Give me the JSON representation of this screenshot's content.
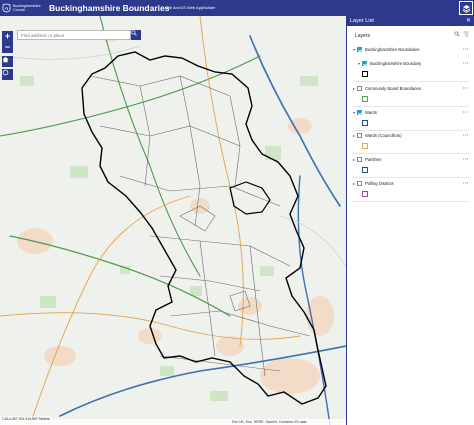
{
  "header": {
    "logo_text": "Buckinghamshire Council",
    "title": "Buckinghamshire Boundaries",
    "subtitle": "with ArcGIS Web AppBuilder"
  },
  "search": {
    "placeholder": "Find address or place"
  },
  "zoom": {
    "in_label": "+",
    "out_label": "−"
  },
  "map": {
    "scale_text": "1,614,337 291,914,597 Meters",
    "attribution": "Esri UK, Esri, HERE, Garmin, Contains OS data"
  },
  "panel": {
    "title": "Layer List",
    "close_label": "✕",
    "layers_label": "Layers",
    "items": [
      {
        "label": "Buckinghamshire Boundaries",
        "checked": true,
        "swatch": ""
      },
      {
        "label": "Buckinghamshire Boundary",
        "checked": true,
        "swatch": "#000000"
      },
      {
        "label": "Community Board Boundaries",
        "checked": false,
        "swatch": "#4aa84a"
      },
      {
        "label": "Wards",
        "checked": true,
        "swatch": "#1f4f8f"
      },
      {
        "label": "Wards (Councillors)",
        "checked": false,
        "swatch": "#e8a84a"
      },
      {
        "label": "Parishes",
        "checked": false,
        "swatch": "#1f4f8f"
      },
      {
        "label": "Polling Districts",
        "checked": false,
        "swatch": "#b33fb3"
      }
    ]
  },
  "colors": {
    "brand": "#2d3a8c",
    "checkbox": "#1aa6c9",
    "boundary": "#000000",
    "wards": "#6a6a6a"
  }
}
